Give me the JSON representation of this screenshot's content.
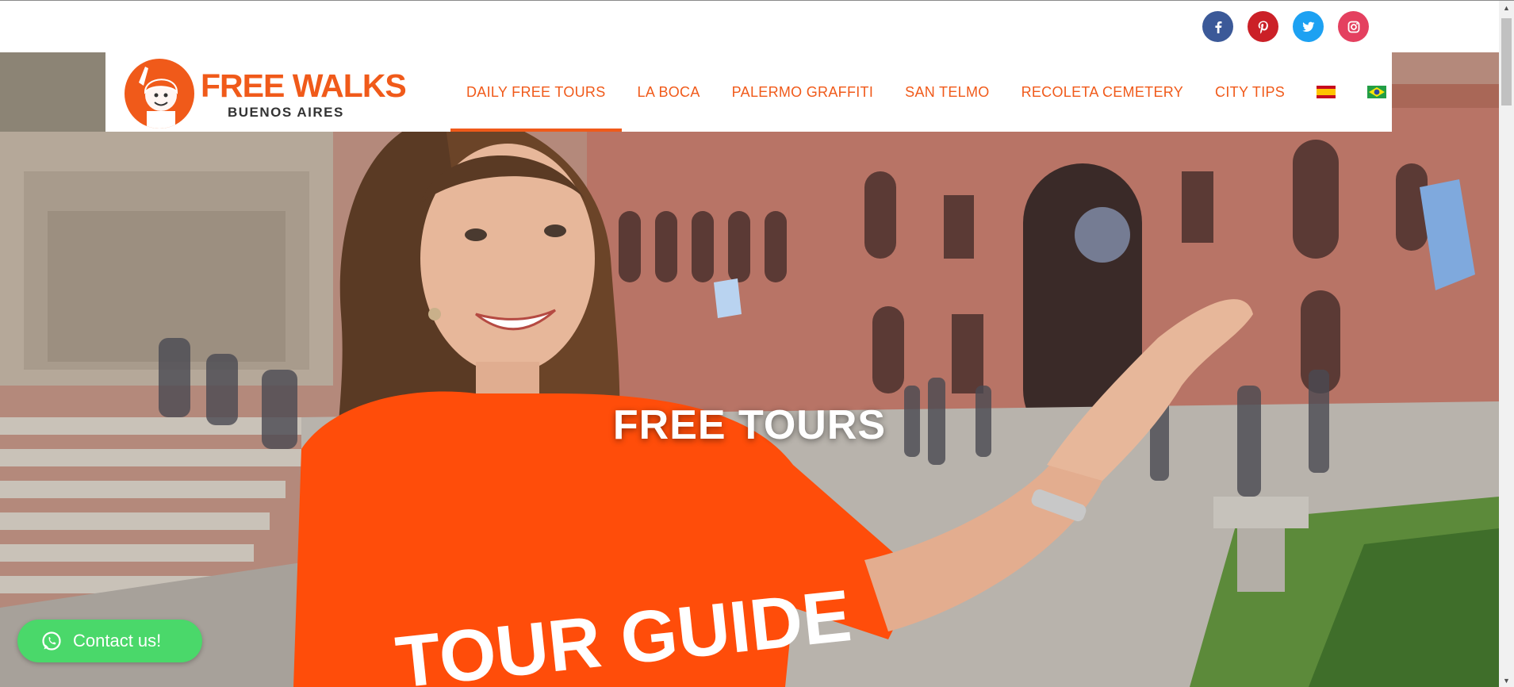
{
  "social": [
    {
      "name": "facebook",
      "icon": "facebook-icon",
      "glyph": "f",
      "color": "#3b5998"
    },
    {
      "name": "pinterest",
      "icon": "pinterest-icon",
      "glyph": "p",
      "color": "#cb2027"
    },
    {
      "name": "twitter",
      "icon": "twitter-icon",
      "glyph": "t",
      "color": "#1da1f2"
    },
    {
      "name": "instagram",
      "icon": "instagram-icon",
      "glyph": "i",
      "color": "#e4405f"
    }
  ],
  "logo": {
    "title": "FREE WALKS",
    "subtitle": "BUENOS AIRES",
    "color": "#f05a1a"
  },
  "nav": {
    "items": [
      {
        "label": "DAILY FREE TOURS",
        "active": true
      },
      {
        "label": "LA BOCA",
        "active": false
      },
      {
        "label": "PALERMO GRAFFITI",
        "active": false
      },
      {
        "label": "SAN TELMO",
        "active": false
      },
      {
        "label": "RECOLETA CEMETERY",
        "active": false
      },
      {
        "label": "CITY TIPS",
        "active": false
      }
    ],
    "flags": [
      {
        "name": "spanish-flag-icon"
      },
      {
        "name": "brazil-flag-icon"
      }
    ],
    "accent_color": "#f05a1a"
  },
  "hero": {
    "title": "FREE TOURS",
    "shirt_text": "TOUR GUIDE"
  },
  "contact": {
    "label": "Contact us!",
    "icon": "whatsapp-icon",
    "color": "#4ad86a"
  }
}
